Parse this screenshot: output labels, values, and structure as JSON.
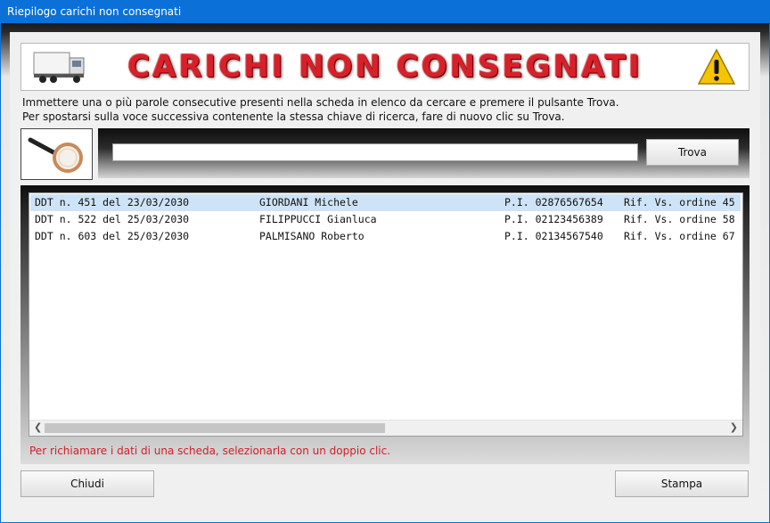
{
  "window": {
    "title": "Riepilogo carichi non consegnati"
  },
  "banner": {
    "title": "CARICHI NON CONSEGNATI"
  },
  "instructions": {
    "line1": "Immettere una o più parole consecutive presenti nella scheda in elenco da cercare e premere il pulsante Trova.",
    "line2": "Per spostarsi sulla voce successiva contenente la stessa chiave di ricerca, fare di nuovo clic su Trova."
  },
  "search": {
    "value": "",
    "button_label": "Trova"
  },
  "list": {
    "rows": [
      {
        "ddt": "DDT n. 451 del 23/03/2030",
        "name": "GIORDANI Michele",
        "piva": "P.I. 02876567654",
        "rif": "Rif. Vs. ordine 45",
        "selected": true
      },
      {
        "ddt": "DDT n. 522 del 25/03/2030",
        "name": "FILIPPUCCI Gianluca",
        "piva": "P.I. 02123456389",
        "rif": "Rif. Vs. ordine 58",
        "selected": false
      },
      {
        "ddt": "DDT n. 603 del 25/03/2030",
        "name": "PALMISANO Roberto",
        "piva": "P.I. 02134567540",
        "rif": "Rif. Vs. ordine 67",
        "selected": false
      }
    ],
    "hint": "Per richiamare i dati di una scheda, selezionarla con un doppio clic."
  },
  "footer": {
    "close_label": "Chiudi",
    "print_label": "Stampa"
  },
  "colors": {
    "title_bar": "#0b70d8",
    "banner_title": "#d8202a",
    "hint": "#d0202a",
    "selection": "#cde3f7"
  },
  "icons": {
    "truck": "truck-icon",
    "warning": "warning-icon",
    "magnifier": "magnifier-icon"
  }
}
